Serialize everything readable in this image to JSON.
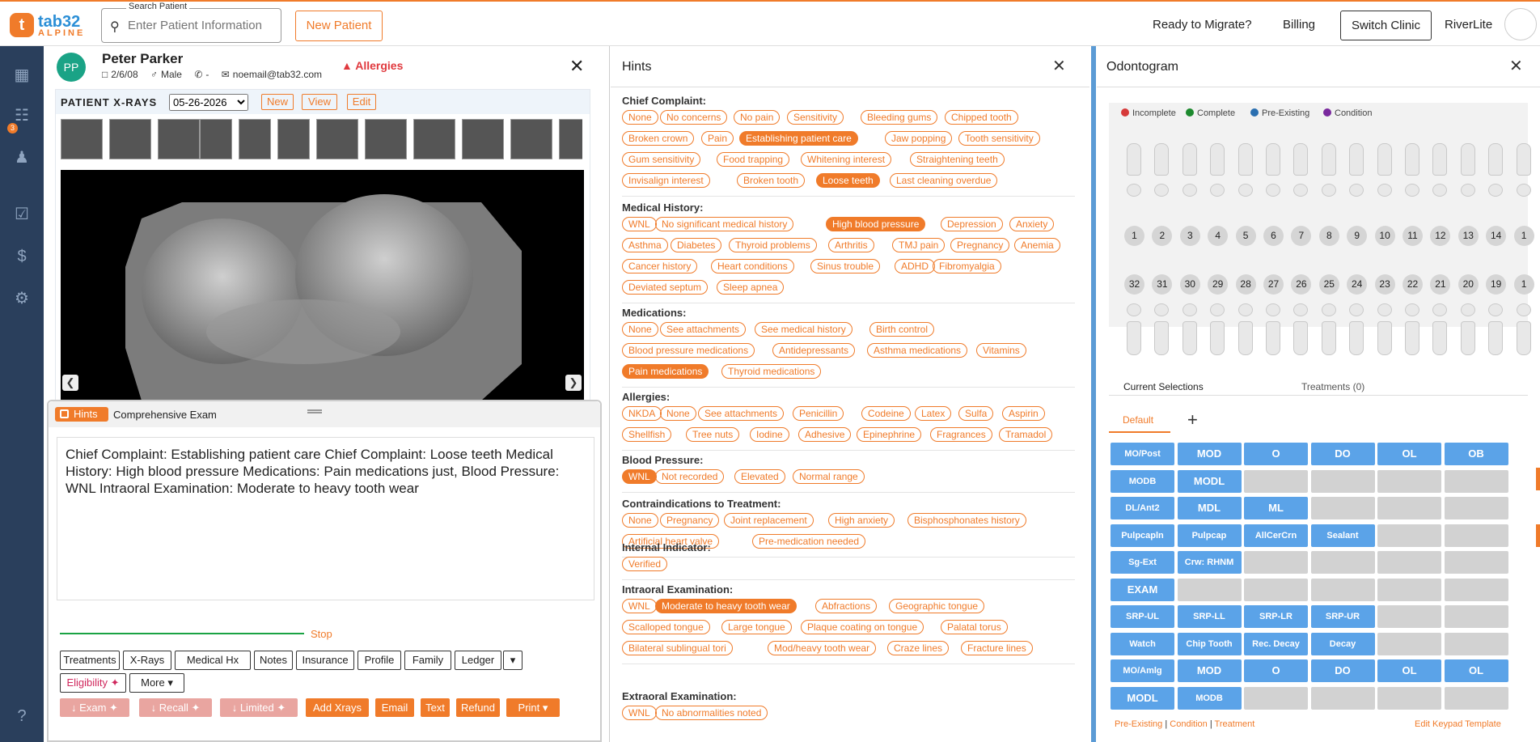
{
  "topbar": {
    "logo_text": "tab32",
    "logo_sub": "ALPINE",
    "search_label": "Search Patient",
    "search_placeholder": "Enter Patient Information",
    "new_patient": "New Patient",
    "ready_to_migrate": "Ready to Migrate?",
    "billing": "Billing",
    "switch_clinic": "Switch Clinic",
    "clinic_name": "RiverLite"
  },
  "nav": {
    "badge": "3"
  },
  "patient": {
    "initials": "PP",
    "name": "Peter Parker",
    "dob": "2/6/08",
    "gender": "Male",
    "phone": "-",
    "email": "noemail@tab32.com",
    "allergies": "Allergies"
  },
  "xrays": {
    "title": "PATIENT X-RAYS",
    "date": "05-26-2026",
    "new": "New",
    "view": "View",
    "edit": "Edit"
  },
  "hints_bar": {
    "pill": "Hints",
    "name": "Comprehensive Exam",
    "note_text": "Chief Complaint: Establishing patient care Chief Complaint: Loose teeth Medical History: High blood pressure Medications: Pain medications just, Blood Pressure: WNL Intraoral Examination: Moderate to heavy tooth wear",
    "stop": "Stop",
    "tabs": [
      "Treatments",
      "X-Rays",
      "Medical Hx",
      "Notes",
      "Insurance",
      "Profile",
      "Family",
      "Ledger"
    ],
    "eligibility": "Eligibility",
    "more": "More",
    "actions": {
      "exam": "Exam",
      "recall": "Recall",
      "limited": "Limited",
      "add_xrays": "Add Xrays",
      "email": "Email",
      "text": "Text",
      "refund": "Refund",
      "print": "Print"
    }
  },
  "hints_panel": {
    "title": "Hints",
    "sections": [
      {
        "title": "Chief Complaint:",
        "rows": [
          [
            {
              "t": "None"
            },
            {
              "t": "No concerns"
            },
            {
              "t": "No pain"
            },
            {
              "t": "Sensitivity"
            },
            {
              "t": "Bleeding gums"
            },
            {
              "t": "Chipped tooth"
            }
          ],
          [
            {
              "t": "Broken crown"
            },
            {
              "t": "Pain"
            },
            {
              "t": "Establishing patient care",
              "s": true
            },
            {
              "t": "Jaw popping"
            },
            {
              "t": "Tooth sensitivity"
            }
          ],
          [
            {
              "t": "Gum sensitivity"
            },
            {
              "t": "Food trapping"
            },
            {
              "t": "Whitening interest"
            },
            {
              "t": "Straightening teeth"
            }
          ],
          [
            {
              "t": "Invisalign interest"
            },
            {
              "t": "Broken tooth"
            },
            {
              "t": "Loose teeth",
              "s": true
            },
            {
              "t": "Last cleaning overdue"
            }
          ]
        ]
      },
      {
        "title": "Medical History:",
        "rows": [
          [
            {
              "t": "WNL"
            },
            {
              "t": "No significant medical history"
            },
            {
              "t": "High blood pressure",
              "s": true
            },
            {
              "t": "Depression"
            },
            {
              "t": "Anxiety"
            }
          ],
          [
            {
              "t": "Asthma"
            },
            {
              "t": "Diabetes"
            },
            {
              "t": "Thyroid problems"
            },
            {
              "t": "Arthritis"
            },
            {
              "t": "TMJ pain"
            },
            {
              "t": "Pregnancy"
            },
            {
              "t": "Anemia"
            }
          ],
          [
            {
              "t": "Cancer history"
            },
            {
              "t": "Heart conditions"
            },
            {
              "t": "Sinus trouble"
            },
            {
              "t": "ADHD"
            },
            {
              "t": "Fibromyalgia"
            }
          ],
          [
            {
              "t": "Deviated septum"
            },
            {
              "t": "Sleep apnea"
            }
          ]
        ]
      },
      {
        "title": "Medications:",
        "rows": [
          [
            {
              "t": "None"
            },
            {
              "t": "See attachments"
            },
            {
              "t": "See medical history"
            },
            {
              "t": "Birth control"
            }
          ],
          [
            {
              "t": "Blood pressure medications"
            },
            {
              "t": "Antidepressants"
            },
            {
              "t": "Asthma medications"
            },
            {
              "t": "Vitamins"
            }
          ],
          [
            {
              "t": "Pain medications",
              "s": true
            },
            {
              "t": "Thyroid medications"
            }
          ]
        ]
      },
      {
        "title": "Allergies:",
        "rows": [
          [
            {
              "t": "NKDA"
            },
            {
              "t": "None"
            },
            {
              "t": "See attachments"
            },
            {
              "t": "Penicillin"
            },
            {
              "t": "Codeine"
            },
            {
              "t": "Latex"
            },
            {
              "t": "Sulfa"
            },
            {
              "t": "Aspirin"
            }
          ],
          [
            {
              "t": "Shellfish"
            },
            {
              "t": "Tree nuts"
            },
            {
              "t": "Iodine"
            },
            {
              "t": "Adhesive"
            },
            {
              "t": "Epinephrine"
            },
            {
              "t": "Fragrances"
            },
            {
              "t": "Tramadol"
            }
          ]
        ]
      },
      {
        "title": "Blood Pressure:",
        "rows": [
          [
            {
              "t": "WNL",
              "s": true
            },
            {
              "t": "Not recorded"
            },
            {
              "t": "Elevated"
            },
            {
              "t": "Normal range"
            }
          ]
        ]
      },
      {
        "title": "Contraindications to Treatment:",
        "rows": [
          [
            {
              "t": "None"
            },
            {
              "t": "Pregnancy"
            },
            {
              "t": "Joint replacement"
            },
            {
              "t": "High anxiety"
            },
            {
              "t": "Bisphosphonates history"
            }
          ],
          [
            {
              "t": "Artificial heart valve"
            },
            {
              "t": "Pre-medication needed"
            }
          ]
        ]
      },
      {
        "title": "Internal Indicator:",
        "rows": [
          [
            {
              "t": "Verified"
            }
          ]
        ]
      },
      {
        "title": "Intraoral Examination:",
        "rows": [
          [
            {
              "t": "WNL"
            },
            {
              "t": "Moderate to heavy tooth wear",
              "s": true
            },
            {
              "t": "Abfractions"
            },
            {
              "t": "Geographic tongue"
            }
          ],
          [
            {
              "t": "Scalloped tongue"
            },
            {
              "t": "Large tongue"
            },
            {
              "t": "Plaque coating on tongue"
            },
            {
              "t": "Palatal torus"
            }
          ],
          [
            {
              "t": "Bilateral sublingual tori"
            },
            {
              "t": "Mod/heavy tooth wear"
            },
            {
              "t": "Craze lines"
            },
            {
              "t": "Fracture lines"
            }
          ]
        ]
      },
      {
        "title": "Extraoral Examination:",
        "rows": [
          [
            {
              "t": "WNL"
            },
            {
              "t": "No abnormalities noted"
            }
          ]
        ]
      }
    ]
  },
  "odontogram": {
    "title": "Odontogram",
    "legend": [
      {
        "label": "Incomplete",
        "color": "#d63a3a"
      },
      {
        "label": "Complete",
        "color": "#1d8a2e"
      },
      {
        "label": "Pre-Existing",
        "color": "#2a6fb0"
      },
      {
        "label": "Condition",
        "color": "#7a2a9e"
      }
    ],
    "upper_numbers": [
      "1",
      "2",
      "3",
      "4",
      "5",
      "6",
      "7",
      "8",
      "9",
      "10",
      "11",
      "12",
      "13",
      "14",
      "1"
    ],
    "lower_numbers": [
      "32",
      "31",
      "30",
      "29",
      "28",
      "27",
      "26",
      "25",
      "24",
      "23",
      "22",
      "21",
      "20",
      "19",
      "1"
    ],
    "current_selections": "Current Selections",
    "treatments": "Treatments (0)",
    "default_tab": "Default",
    "add_tab": "+",
    "keypad": [
      [
        "MO/Post",
        "MOD",
        "O",
        "DO",
        "OL",
        "OB"
      ],
      [
        "MODB",
        "MODL",
        "",
        "",
        "",
        ""
      ],
      [
        "DL/Ant2",
        "MDL",
        "ML",
        "",
        "",
        ""
      ],
      [
        "Pulpcapln",
        "Pulpcap",
        "AllCerCrn",
        "Sealant",
        "",
        ""
      ],
      [
        "Sg-Ext",
        "Crw: RHNM",
        "",
        "",
        "",
        ""
      ],
      [
        "EXAM",
        "",
        "",
        "",
        "",
        ""
      ],
      [
        "SRP-UL",
        "SRP-LL",
        "SRP-LR",
        "SRP-UR",
        "",
        ""
      ],
      [
        "Watch",
        "Chip Tooth",
        "Rec. Decay",
        "Decay",
        "",
        ""
      ],
      [
        "MO/Amlg",
        "MOD",
        "O",
        "DO",
        "OL",
        "OL"
      ],
      [
        "MODL",
        "MODB",
        "",
        "",
        "",
        ""
      ]
    ],
    "footer_pre": "Pre-Existing",
    "footer_cond": "Condition",
    "footer_treat": "Treatment",
    "sep": "|",
    "edit_keypad": "Edit Keypad Template"
  }
}
